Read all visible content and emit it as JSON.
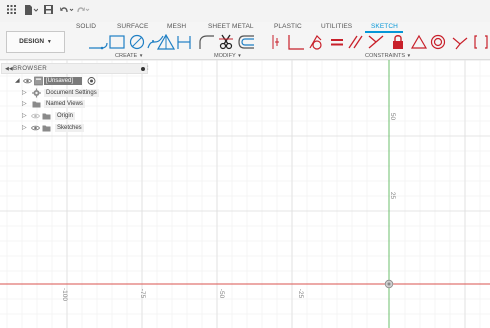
{
  "quick_access": {
    "icons": [
      "grid-menu-icon",
      "file-menu-icon",
      "save-icon",
      "undo-icon",
      "redo-icon"
    ]
  },
  "ribbon": {
    "workspace_button": "DESIGN",
    "tabs": [
      {
        "label": "SOLID",
        "active": false
      },
      {
        "label": "SURFACE",
        "active": false
      },
      {
        "label": "MESH",
        "active": false
      },
      {
        "label": "SHEET METAL",
        "active": false
      },
      {
        "label": "PLASTIC",
        "active": false
      },
      {
        "label": "UTILITIES",
        "active": false
      },
      {
        "label": "SKETCH",
        "active": true
      }
    ],
    "groups": {
      "create": "CREATE",
      "modify": "MODIFY",
      "constraints": "CONSTRAINTS"
    },
    "accent_color": "#0696d7",
    "constraint_color": "#c8202a"
  },
  "browser": {
    "title": "BROWSER",
    "root": "[Unsaved]",
    "items": [
      {
        "label": "Document Settings",
        "icon": "gear-icon"
      },
      {
        "label": "Named Views",
        "icon": "folder-icon"
      },
      {
        "label": "Origin",
        "icon": "folder-icon"
      },
      {
        "label": "Sketches",
        "icon": "folder-icon"
      }
    ]
  },
  "viewport": {
    "x_labels": [
      "-100",
      "-75",
      "-50",
      "-25"
    ],
    "y_labels": [
      "50",
      "25"
    ],
    "x_axis_color": "#d9534f",
    "y_axis_color": "#5cb85c"
  }
}
